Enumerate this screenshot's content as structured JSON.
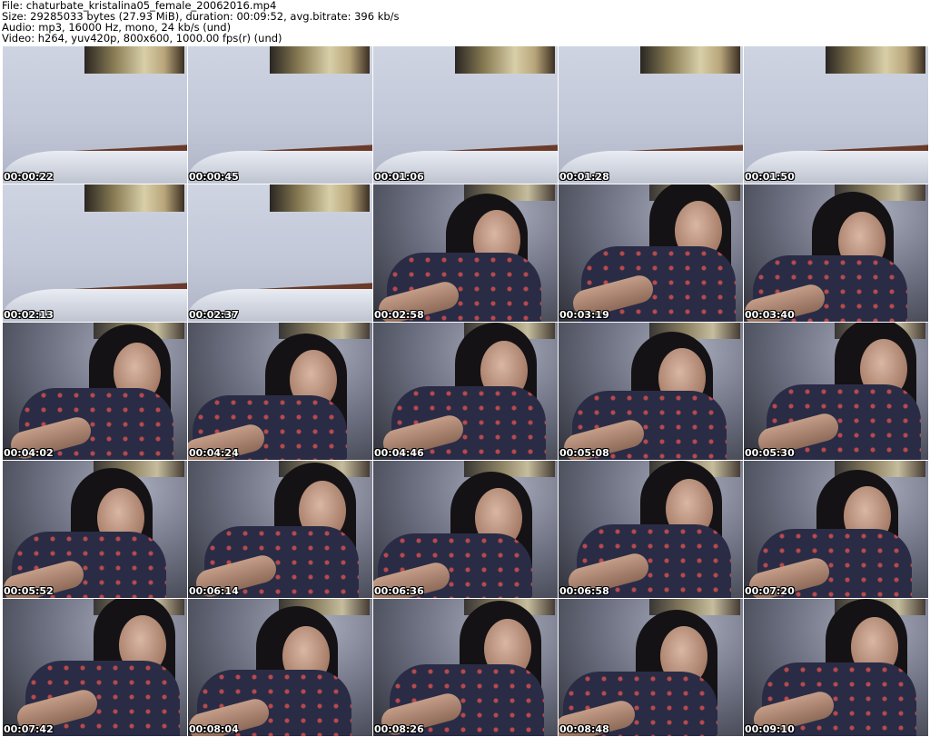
{
  "header": {
    "file": "File: chaturbate_kristalina05_female_20062016.mp4",
    "size": "Size: 29285033 bytes (27.93 MiB), duration: 00:09:52, avg.bitrate: 396 kb/s",
    "audio": "Audio: mp3, 16000 Hz, mono, 24 kb/s (und)",
    "video": "Video: h264, yuv420p, 800x600, 1000.00 fps(r) (und)"
  },
  "thumbnails": [
    {
      "time": "00:00:22",
      "scene": "bed"
    },
    {
      "time": "00:00:45",
      "scene": "bed"
    },
    {
      "time": "00:01:06",
      "scene": "bed"
    },
    {
      "time": "00:01:28",
      "scene": "bed"
    },
    {
      "time": "00:01:50",
      "scene": "bed"
    },
    {
      "time": "00:02:13",
      "scene": "bed"
    },
    {
      "time": "00:02:37",
      "scene": "bed"
    },
    {
      "time": "00:02:58",
      "scene": "person"
    },
    {
      "time": "00:03:19",
      "scene": "person"
    },
    {
      "time": "00:03:40",
      "scene": "person"
    },
    {
      "time": "00:04:02",
      "scene": "person"
    },
    {
      "time": "00:04:24",
      "scene": "person"
    },
    {
      "time": "00:04:46",
      "scene": "person"
    },
    {
      "time": "00:05:08",
      "scene": "person"
    },
    {
      "time": "00:05:30",
      "scene": "person"
    },
    {
      "time": "00:05:52",
      "scene": "person"
    },
    {
      "time": "00:06:14",
      "scene": "person"
    },
    {
      "time": "00:06:36",
      "scene": "person"
    },
    {
      "time": "00:06:58",
      "scene": "person"
    },
    {
      "time": "00:07:20",
      "scene": "person"
    },
    {
      "time": "00:07:42",
      "scene": "person"
    },
    {
      "time": "00:08:04",
      "scene": "person"
    },
    {
      "time": "00:08:26",
      "scene": "person"
    },
    {
      "time": "00:08:48",
      "scene": "person"
    },
    {
      "time": "00:09:10",
      "scene": "person"
    }
  ]
}
